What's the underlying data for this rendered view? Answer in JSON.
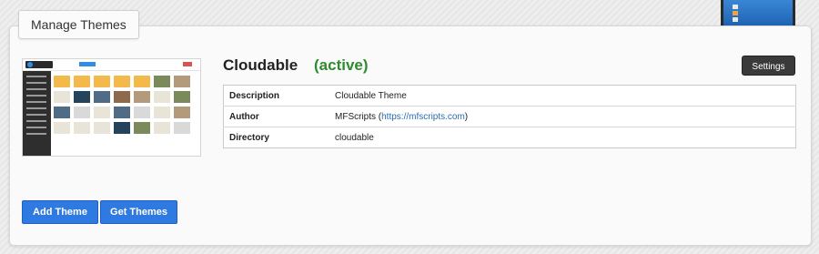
{
  "panel": {
    "title": "Manage Themes"
  },
  "theme": {
    "name": "Cloudable",
    "status": "(active)",
    "settings_label": "Settings",
    "preview_logo": "Cloudable",
    "details": [
      {
        "label": "Description",
        "value": "Cloudable Theme"
      },
      {
        "label": "Author",
        "value_prefix": "MFScripts (",
        "link": "https://mfscripts.com",
        "value_suffix": ")"
      },
      {
        "label": "Directory",
        "value": "cloudable"
      }
    ]
  },
  "actions": {
    "add_theme": "Add Theme",
    "get_themes": "Get Themes"
  },
  "colors": {
    "accent": "#2f7ae0",
    "active": "#2e8b2e",
    "dark_button": "#3a3a3a"
  },
  "icons": [
    "monitor-icon"
  ]
}
